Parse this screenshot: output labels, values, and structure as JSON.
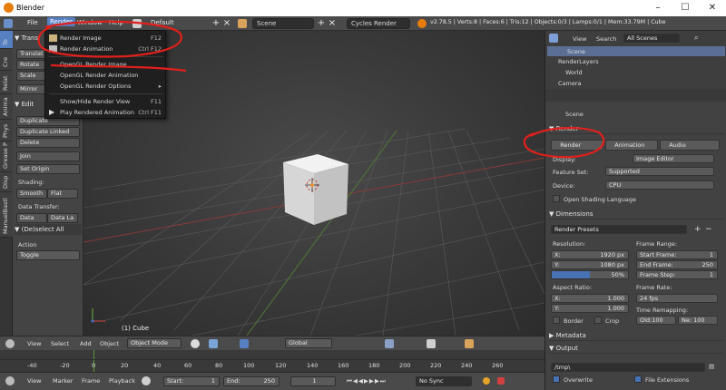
{
  "window": {
    "title": "Blender"
  },
  "infobar": {
    "menus": [
      "File",
      "Render",
      "Window",
      "Help"
    ],
    "layout": "Default",
    "scene": "Scene",
    "engine": "Cycles Render",
    "stats": "v2.78.5 | Verts:8 | Faces:6 | Tris:12 | Objects:0/3 | Lamps:0/1 | Mem:33.79M | Cube"
  },
  "render_menu": {
    "items": [
      {
        "label": "Render Image",
        "shortcut": "F12"
      },
      {
        "label": "Render Animation",
        "shortcut": "Ctrl F12"
      },
      {
        "label": "OpenGL Render Image",
        "shortcut": ""
      },
      {
        "label": "OpenGL Render Animation",
        "shortcut": ""
      },
      {
        "label": "OpenGL Render Options",
        "shortcut": "▸"
      },
      {
        "label": "Show/Hide Render View",
        "shortcut": "F11"
      },
      {
        "label": "Play Rendered Animation",
        "shortcut": "Ctrl F11"
      }
    ]
  },
  "left_tabs": [
    "To",
    "Cre",
    "Relat",
    "Anima",
    "Phys",
    "Grease P",
    "Disp",
    "ManuelBastl"
  ],
  "toolshelf": {
    "transform_header": "Transf",
    "transform_buttons": [
      "Translat",
      "Rotate",
      "Scale",
      "Mirror"
    ],
    "edit_header": "Edit",
    "edit_buttons": [
      "Duplicate",
      "Duplicate Linked",
      "Delete",
      "Join",
      "Set Origin"
    ],
    "shading_label": "Shading:",
    "shading_buttons": [
      "Smooth",
      "Flat"
    ],
    "data_transfer_label": "Data Transfer:",
    "data_transfer_buttons": [
      "Data",
      "Data La"
    ],
    "deselect_header": "(De)select All",
    "action_label": "Action",
    "action_value": "Toggle"
  },
  "viewport": {
    "object_label": "(1) Cube"
  },
  "outliner": {
    "tabs": [
      "View",
      "Search",
      "All Scenes"
    ],
    "items": [
      "Scene",
      "RenderLayers",
      "World",
      "Camera"
    ]
  },
  "properties": {
    "breadcrumb": "Scene",
    "render_header": "Render",
    "render_buttons": [
      "Render",
      "Animation",
      "Audio"
    ],
    "display_label": "Display:",
    "display_value": "Image Editor",
    "feature_set_label": "Feature Set:",
    "feature_set_value": "Supported",
    "device_label": "Device:",
    "device_value": "CPU",
    "osl_label": "Open Shading Language",
    "dimensions_header": "Dimensions",
    "render_presets": "Render Presets",
    "resolution_label": "Resolution:",
    "res_x_label": "X:",
    "res_x": "1920 px",
    "res_y_label": "Y:",
    "res_y": "1080 px",
    "res_pct": "50%",
    "res_pct_value": 0.5,
    "aspect_label": "Aspect Ratio:",
    "aspect_x_label": "X:",
    "aspect_x": "1.000",
    "aspect_y_label": "Y:",
    "aspect_y": "1.000",
    "border_label": "Border",
    "crop_label": "Crop",
    "frame_range_label": "Frame Range:",
    "start_frame_label": "Start Frame:",
    "start_frame": "1",
    "end_frame_label": "End Frame:",
    "end_frame": "250",
    "frame_step_label": "Frame Step:",
    "frame_step": "1",
    "frame_rate_label": "Frame Rate:",
    "frame_rate": "24 fps",
    "time_remap_label": "Time Remapping:",
    "old_label": "Old:100",
    "new_label": "Ne: 100",
    "metadata_header": "Metadata",
    "output_header": "Output",
    "output_path": "/tmp\\",
    "overwrite_label": "Overwrite",
    "file_ext_label": "File Extensions"
  },
  "view_header": {
    "items": [
      "View",
      "Select",
      "Add",
      "Object"
    ],
    "mode": "Object Mode",
    "orientation": "Global"
  },
  "timeline": {
    "ticks": [
      "-40",
      "-20",
      "0",
      "20",
      "40",
      "60",
      "80",
      "100",
      "120",
      "140",
      "160",
      "180",
      "200",
      "220",
      "240",
      "260"
    ]
  },
  "timeline_header": {
    "items": [
      "View",
      "Marker",
      "Frame",
      "Playback"
    ],
    "start_label": "Start:",
    "start": "1",
    "end_label": "End:",
    "end": "250",
    "current": "1",
    "sync": "No Sync"
  },
  "annotations": {
    "color": "#e0201c"
  }
}
